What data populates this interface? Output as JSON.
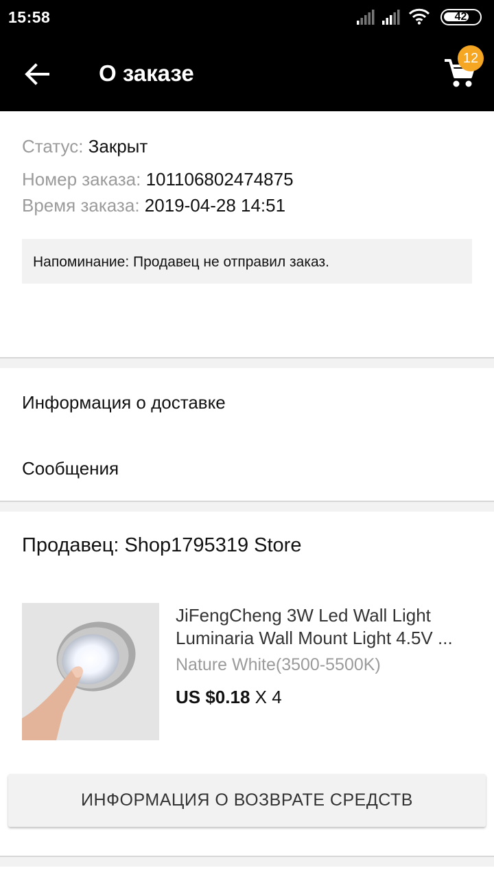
{
  "status_bar": {
    "time": "15:58",
    "battery": "42",
    "icons": [
      "signal-icon",
      "signal-icon",
      "wifi-icon",
      "battery-icon"
    ]
  },
  "app_bar": {
    "title": "О заказе",
    "cart_count": "12",
    "badge_color": "#f5a623"
  },
  "order": {
    "status_label": "Статус:",
    "status_value": "Закрыт",
    "number_label": "Номер заказа:",
    "number_value": "101106802474875",
    "time_label": "Время заказа:",
    "time_value": "2019-04-28 14:51",
    "reminder": "Напоминание: Продавец не отправил заказ."
  },
  "links": {
    "delivery": "Информация о доставке",
    "messages": "Сообщения"
  },
  "seller": {
    "label": "Продавец: Shop1795319 Store"
  },
  "product": {
    "title": "JiFengCheng 3W Led Wall Light Luminaria Wall Mount Light 4.5V ...",
    "variant": "Nature White(3500-5500K)",
    "price": "US $0.18",
    "quantity": "X 4"
  },
  "refund_button": "ИНФОРМАЦИЯ О ВОЗВРАТЕ СРЕДСТВ"
}
